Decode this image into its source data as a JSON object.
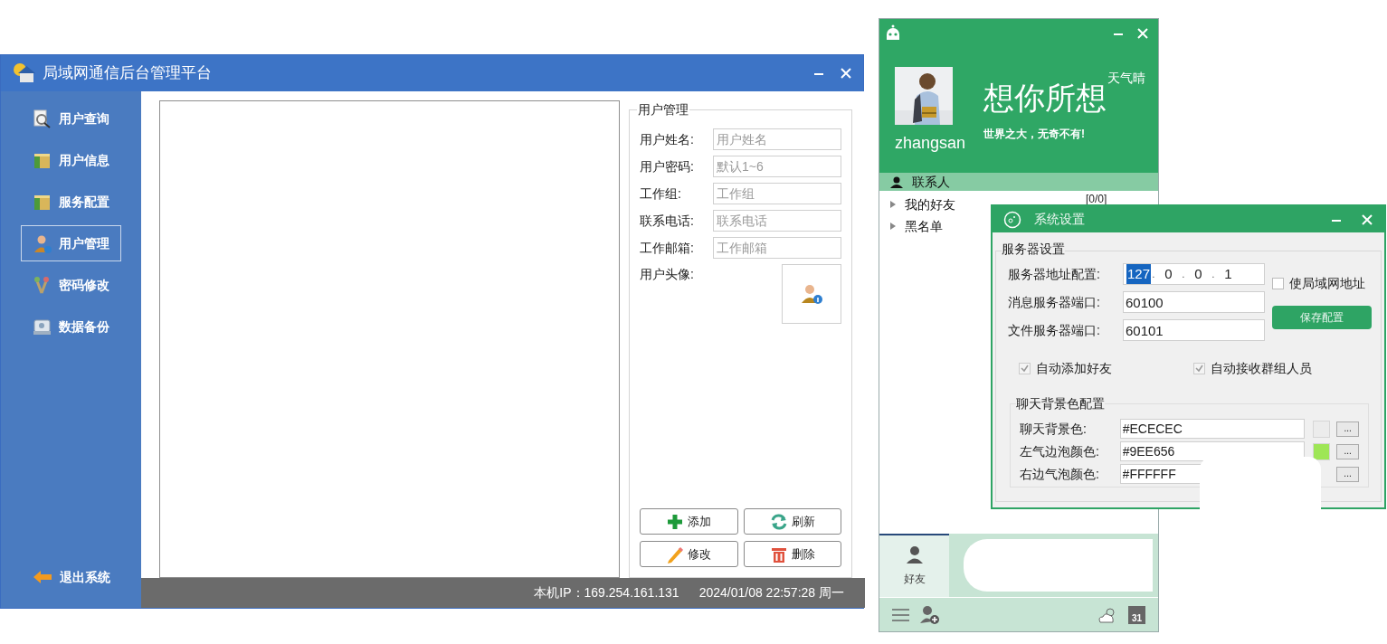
{
  "admin_window": {
    "title": "局域网通信后台管理平台",
    "nav": [
      {
        "label": "用户查询",
        "kind": "search",
        "selected": false
      },
      {
        "label": "用户信息",
        "kind": "box",
        "selected": false
      },
      {
        "label": "服务配置",
        "kind": "box",
        "selected": false
      },
      {
        "label": "用户管理",
        "kind": "user",
        "selected": true
      },
      {
        "label": "密码修改",
        "kind": "keys",
        "selected": false
      },
      {
        "label": "数据备份",
        "kind": "disk",
        "selected": false
      }
    ],
    "exit": {
      "label": "退出系统"
    },
    "form": {
      "title": "用户管理",
      "fields": [
        {
          "label": "用户姓名:",
          "placeholder": "用户姓名"
        },
        {
          "label": "用户密码:",
          "placeholder": "默认1~6"
        },
        {
          "label": "工作组:",
          "placeholder": "工作组"
        },
        {
          "label": "联系电话:",
          "placeholder": "联系电话"
        },
        {
          "label": "工作邮箱:",
          "placeholder": "工作邮箱"
        }
      ],
      "avatar_label": "用户头像:",
      "buttons": [
        {
          "label": "添加",
          "kind": "add"
        },
        {
          "label": "刷新",
          "kind": "refresh"
        },
        {
          "label": "修改",
          "kind": "edit"
        },
        {
          "label": "删除",
          "kind": "delete"
        }
      ]
    },
    "status_bar": {
      "ip": "本机IP：169.254.161.131",
      "datetime": "2024/01/08 22:57:28 周一"
    }
  },
  "chat_window": {
    "weather": "天气晴",
    "slogan": "想你所想",
    "motto": "世界之大，无奇不有!",
    "username": "zhangsan",
    "contacts_label": "联系人",
    "groups": [
      {
        "label": "我的好友",
        "count": "[0/0]"
      },
      {
        "label": "黑名单"
      }
    ],
    "tab": {
      "label": "好友",
      "selected": true
    },
    "calendar_day": "31"
  },
  "settings_window": {
    "title": "系统设置",
    "server_section": "服务器设置",
    "address": {
      "label": "服务器地址配置:",
      "separator": ".",
      "octets": [
        {
          "value": "127",
          "selected": true
        },
        {
          "value": "0",
          "selected": false
        },
        {
          "value": "0",
          "selected": false
        },
        {
          "value": "1",
          "selected": false
        }
      ]
    },
    "ports": [
      {
        "label": "消息服务器端口:",
        "value": "60100"
      },
      {
        "label": "文件服务器端口:",
        "value": "60101"
      }
    ],
    "use_lan": {
      "label": "使局域网地址",
      "checked": false
    },
    "save_button": "保存配置",
    "options": [
      {
        "label": "自动添加好友",
        "checked": true
      },
      {
        "label": "自动接收群组人员",
        "checked": true
      }
    ],
    "color_section": "聊天背景色配置",
    "colors": [
      {
        "label": "聊天背景色:",
        "value": "#ECECEC",
        "color": "#ececec"
      },
      {
        "label": "左气边泡颜色:",
        "value": "#9EE656",
        "color": "#9ee656"
      },
      {
        "label": "右边气泡颜色:",
        "value": "#FFFFFF"
      }
    ],
    "browse_button": "..."
  }
}
